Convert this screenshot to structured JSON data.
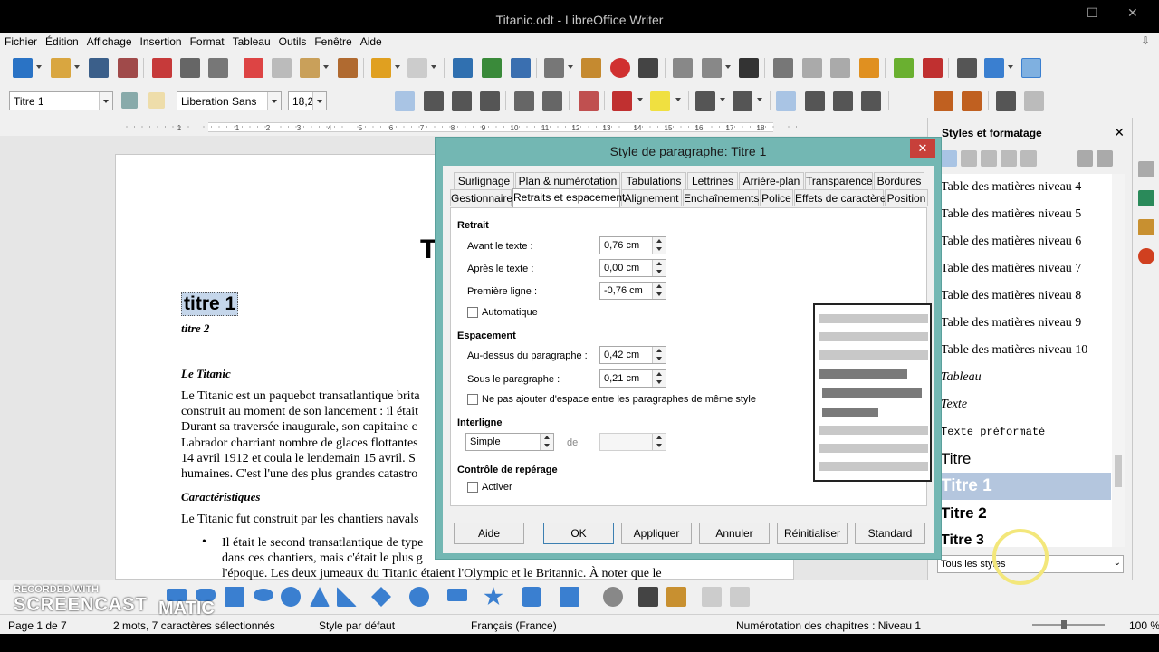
{
  "window": {
    "title": "Titanic.odt - LibreOffice Writer",
    "minimize": "—",
    "maximize": "☐",
    "close": "✕"
  },
  "menu": [
    "Fichier",
    "Édition",
    "Affichage",
    "Insertion",
    "Format",
    "Tableau",
    "Outils",
    "Fenêtre",
    "Aide"
  ],
  "formatting": {
    "paragraph_style": "Titre 1",
    "font_name": "Liberation Sans",
    "font_size": "18,2"
  },
  "ruler_labels": [
    "1",
    "1",
    "2",
    "3",
    "4",
    "5",
    "6",
    "7",
    "8",
    "9",
    "10",
    "11",
    "12",
    "13",
    "14",
    "15",
    "16",
    "17",
    "18"
  ],
  "document": {
    "partial_title": "T",
    "titre1": "titre 1",
    "titre2": "titre 2",
    "h_le_titanic": "Le Titanic",
    "para1": [
      "Le Titanic est un paquebot transatlantique brita",
      "construit au moment de son lancement : il était",
      "Durant sa traversée inaugurale, son capitaine c",
      "Labrador charriant nombre de glaces flottantes",
      "14 avril 1912 et coula le lendemain 15 avril. S",
      "humaines. C'est l'une des plus grandes catastro"
    ],
    "h_caracteristiques": "Caractéristiques",
    "para2": "Le Titanic fut construit par les chantiers navals",
    "bullet1": [
      "Il était le second transatlantique de type",
      "dans ces chantiers, mais c'était le plus g",
      "l'époque. Les deux jumeaux du Titanic étaient l'Olympic et le Britannic. À noter que le"
    ]
  },
  "dialog": {
    "title": "Style de paragraphe: Titre 1",
    "close": "✕",
    "tabs_row1": [
      "Surlignage",
      "Plan & numérotation",
      "Tabulations",
      "Lettrines",
      "Arrière-plan",
      "Transparence",
      "Bordures"
    ],
    "tabs_row2": [
      "Gestionnaire",
      "Retraits et espacement",
      "Alignement",
      "Enchaînements",
      "Police",
      "Effets de caractère",
      "Position"
    ],
    "active_tab": "Retraits et espacement",
    "retrait": {
      "heading": "Retrait",
      "avant_label": "Avant le texte :",
      "avant_value": "0,76 cm",
      "apres_label": "Après le texte :",
      "apres_value": "0,00 cm",
      "premiere_label": "Première ligne :",
      "premiere_value": "-0,76 cm",
      "auto_label": "Automatique"
    },
    "espacement": {
      "heading": "Espacement",
      "dessus_label": "Au-dessus du paragraphe :",
      "dessus_value": "0,42 cm",
      "sous_label": "Sous le paragraphe :",
      "sous_value": "0,21 cm",
      "no_space_label": "Ne pas ajouter d'espace entre les paragraphes de même style"
    },
    "interligne": {
      "heading": "Interligne",
      "value": "Simple",
      "de_label": "de",
      "de_value": ""
    },
    "reperage": {
      "heading": "Contrôle de repérage",
      "activer_label": "Activer"
    },
    "buttons": {
      "aide": "Aide",
      "ok": "OK",
      "appliquer": "Appliquer",
      "annuler": "Annuler",
      "reinitialiser": "Réinitialiser",
      "standard": "Standard"
    }
  },
  "sidebar": {
    "title": "Styles et formatage",
    "close": "✕",
    "items": [
      "Table des matières niveau 4",
      "Table des matières niveau 5",
      "Table des matières niveau 6",
      "Table des matières niveau 7",
      "Table des matières niveau 8",
      "Table des matières niveau 9",
      "Table des matières niveau 10",
      "Tableau",
      "Texte",
      "Texte préformaté",
      "Titre",
      "Titre 1",
      "Titre 2",
      "Titre 3"
    ],
    "selected": "Titre 1",
    "filter": "Tous les styles"
  },
  "status": {
    "page": "Page 1 de 7",
    "words": "2 mots, 7 caractères sélectionnés",
    "page_style": "Style par défaut",
    "language": "Français (France)",
    "outline": "Numérotation des chapitres : Niveau 1",
    "zoom": "100 %"
  },
  "watermark": {
    "line1": "RECORDED WITH",
    "line2": "SCREENCAST",
    "line3": "MATIC"
  },
  "colors": {
    "accent": "#3c7fb1",
    "dialog_frame": "#73b7b3",
    "close_red": "#c7403a",
    "selected_style": "#b4c6de"
  }
}
